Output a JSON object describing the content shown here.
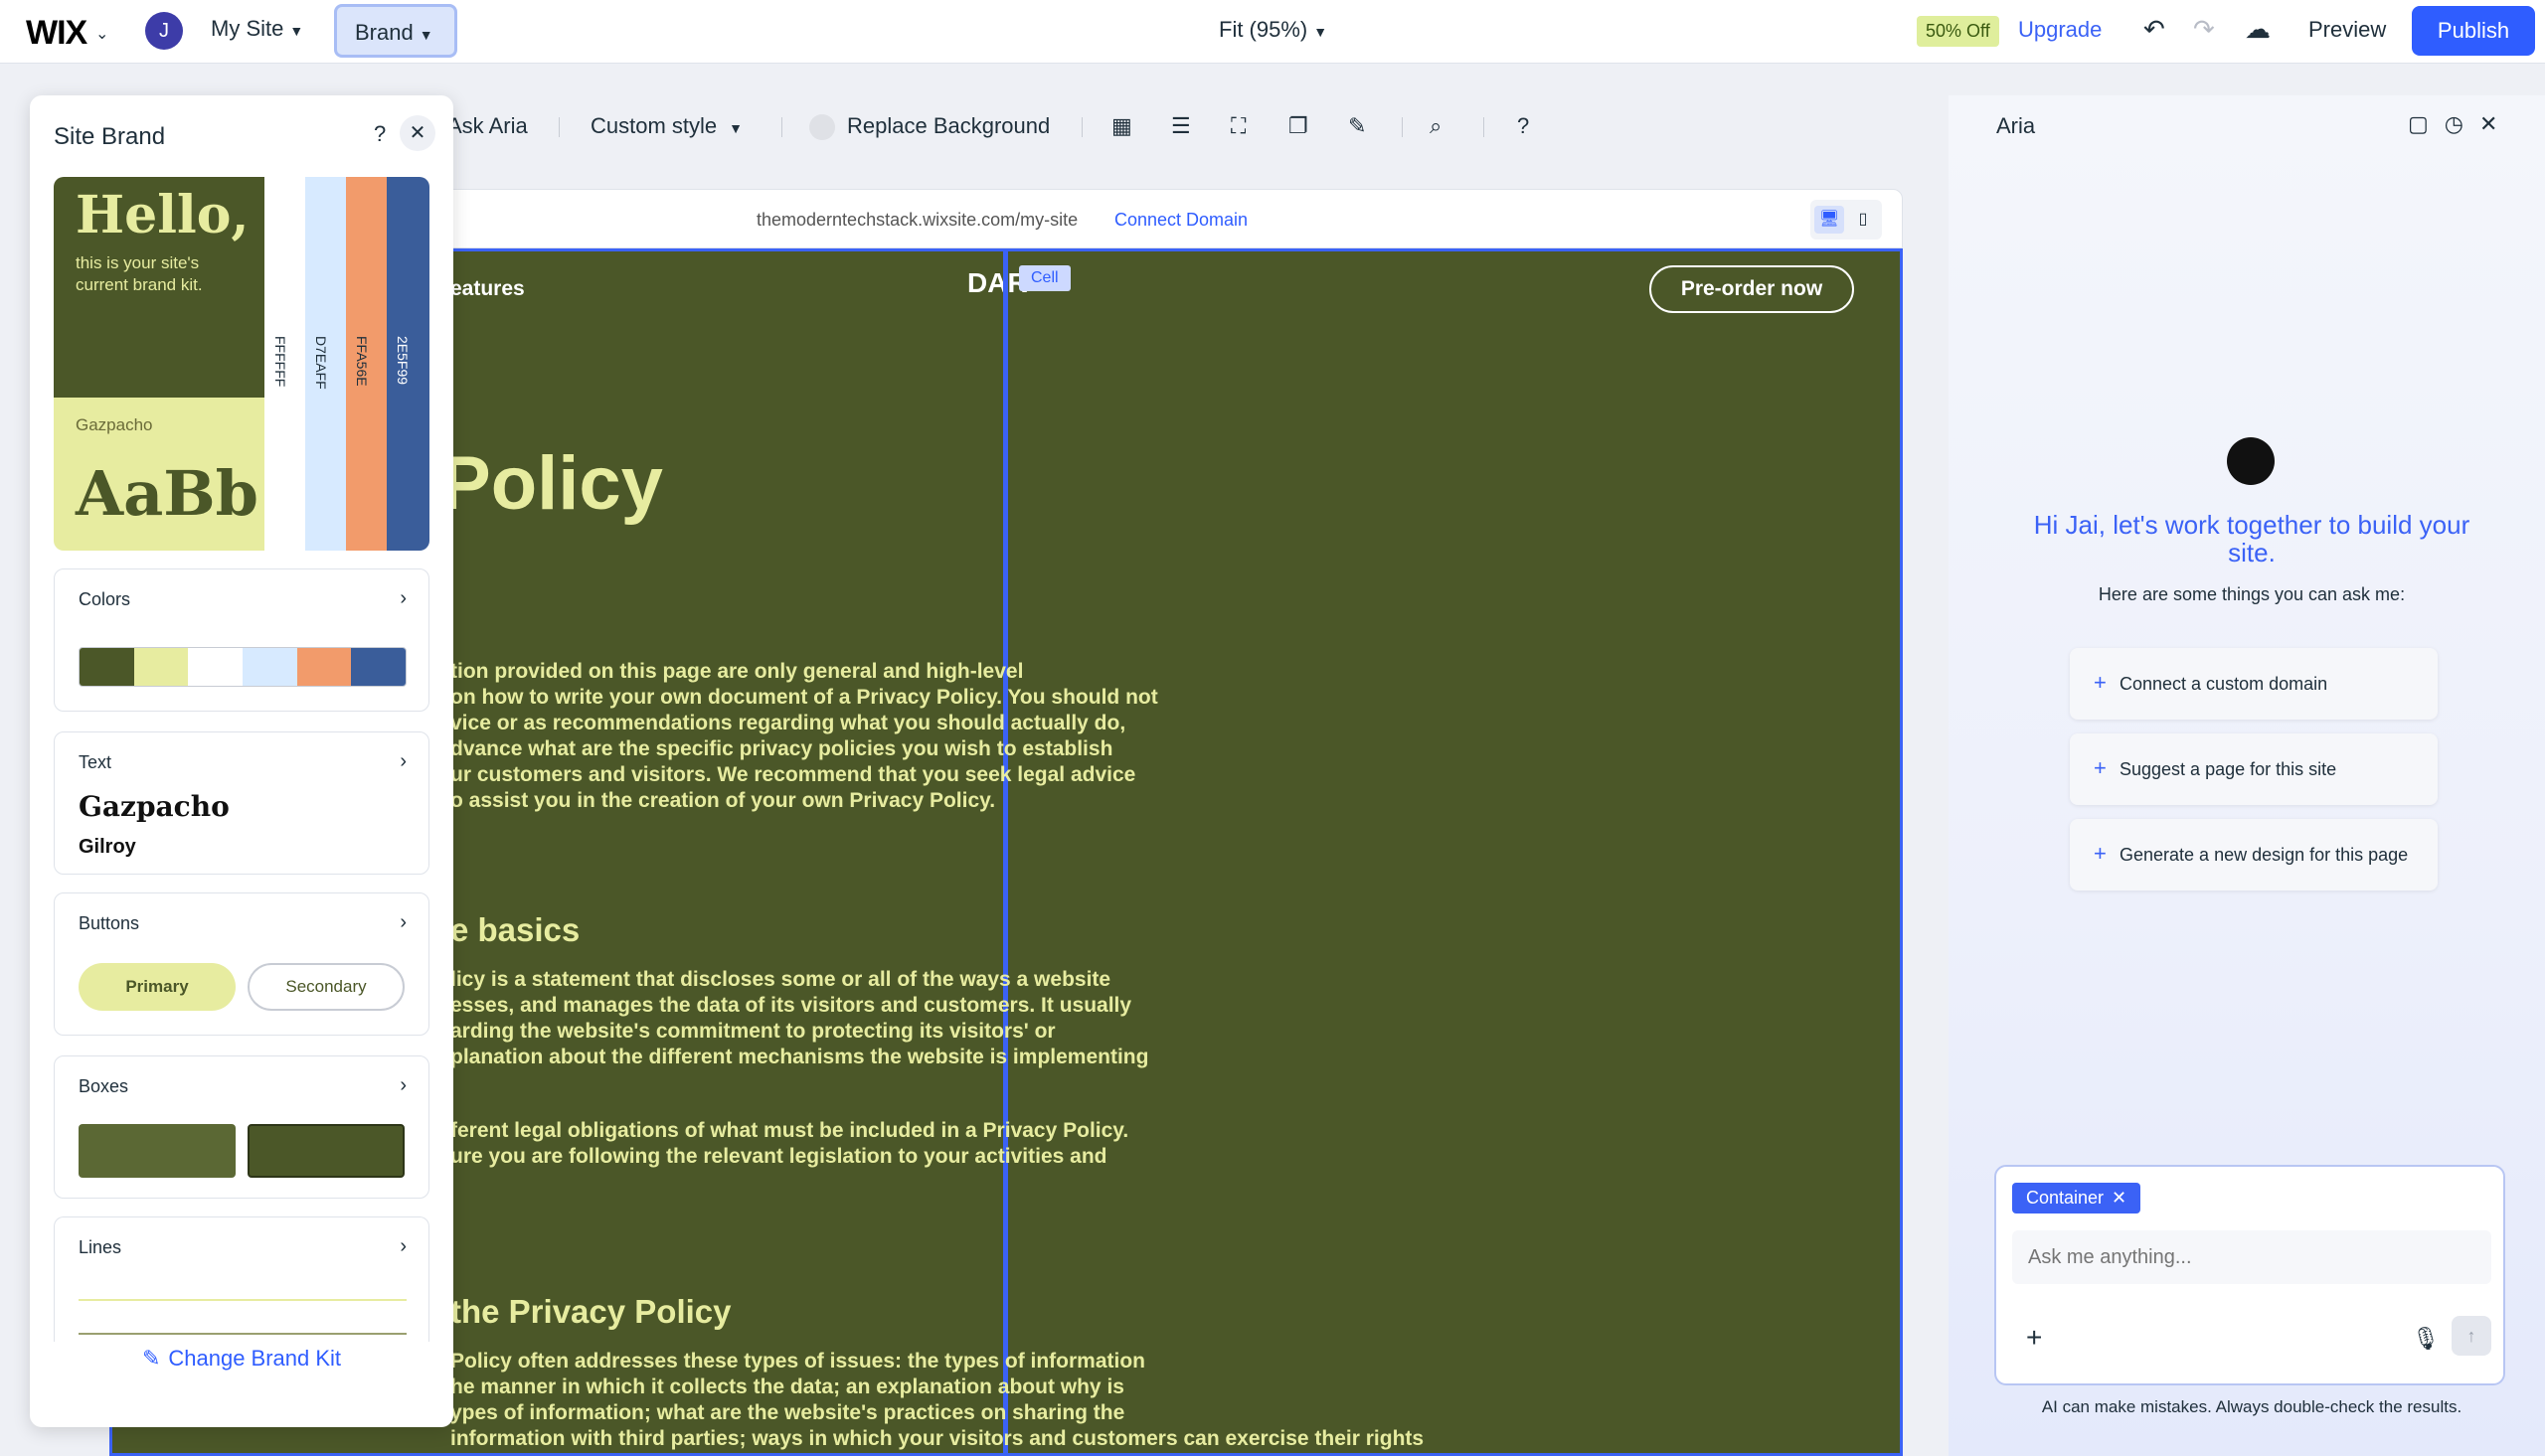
{
  "topbar": {
    "logo": "WIX",
    "avatar_initial": "J",
    "site_menu": "My Site",
    "brand_menu": "Brand",
    "zoom": "Fit (95%)",
    "discount_badge": "50% Off",
    "upgrade": "Upgrade",
    "preview": "Preview",
    "publish": "Publish"
  },
  "toolbar": {
    "ask_aria": "Ask Aria",
    "custom_style": "Custom style",
    "replace_background": "Replace Background",
    "help": "?"
  },
  "browser": {
    "url": "themoderntechstack.wixsite.com/my-site",
    "connect_domain": "Connect Domain"
  },
  "site": {
    "nav_features": "eatures",
    "logo": "DAR",
    "cell_tag": "Cell",
    "preorder": "Pre-order now",
    "heading": "Policy",
    "para1": "tion provided on this page are only general and high-level\n on how to write your own document of a Privacy Policy. You should not\nvice or as recommendations regarding what you should actually do,\ndvance what are the specific privacy policies you wish to establish\nur customers and visitors. We recommend that you seek legal advice\no assist you in the creation of your own Privacy Policy.",
    "h2_basics": "e basics",
    "para2": "licy is a statement that discloses some or all of the ways a website\nesses, and manages the data of its visitors and customers. It usually\narding the website's commitment to protecting its visitors' or\nplanation about the different mechanisms the website is implementing",
    "para3": "ferent legal obligations of what must be included in a Privacy Policy.\nure you are following the relevant legislation to your activities and",
    "h2_privacy": "the Privacy Policy",
    "para4": "Policy often addresses these types of issues: the types of information\nhe manner in which it collects the data; an explanation about why is\nypes of information; what are the website's practices on sharing the\ninformation with third parties; ways in which your visitors and customers can exercise their rights"
  },
  "brand_panel": {
    "title": "Site Brand",
    "help": "?",
    "kit": {
      "hello": "Hello,",
      "subtitle": "this is your site's current brand kit.",
      "font_name": "Gazpacho",
      "sample": "AaBb",
      "stripes": [
        {
          "hex": "FFFFFF",
          "color": "#FFFFFF"
        },
        {
          "hex": "D7EAFF",
          "color": "#D7EAFF"
        },
        {
          "hex": "FFA56E",
          "color": "#F29B6B"
        },
        {
          "hex": "2E5F99",
          "color": "#3A5D9A"
        }
      ]
    },
    "colors": {
      "label": "Colors",
      "swatches": [
        "#4B5728",
        "#E7ECA0",
        "#FFFFFF",
        "#D7EAFF",
        "#F29B6B",
        "#3A5D9A"
      ]
    },
    "text": {
      "label": "Text",
      "heading_font": "Gazpacho",
      "body_font": "Gilroy"
    },
    "buttons": {
      "label": "Buttons",
      "primary": "Primary",
      "secondary": "Secondary"
    },
    "boxes": {
      "label": "Boxes"
    },
    "lines": {
      "label": "Lines"
    },
    "change_kit": "Change Brand Kit"
  },
  "aria": {
    "title": "Aria",
    "greeting": "Hi Jai, let's work together to build your site.",
    "subtitle": "Here are some things you can ask me:",
    "suggestions": [
      "Connect a custom domain",
      "Suggest a page for this site",
      "Generate a new design for this page"
    ],
    "context_chip": "Container",
    "input_placeholder": "Ask me anything...",
    "disclaimer": "AI can make mistakes. Always double-check the results."
  },
  "colors": {
    "accent": "#2F5DFF",
    "site_bg": "#4B5728",
    "site_text": "#E7ECA0"
  }
}
